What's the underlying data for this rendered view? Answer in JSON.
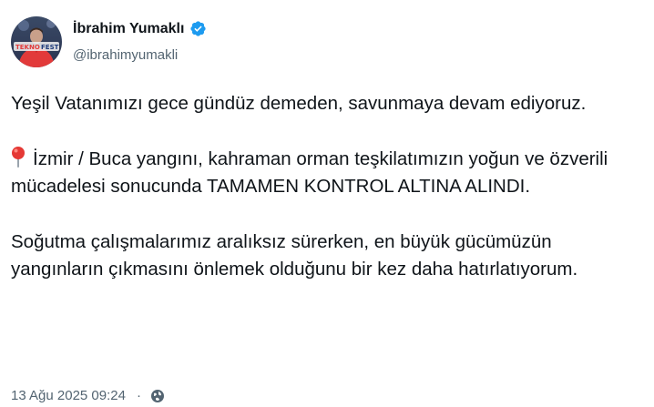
{
  "author": {
    "display_name": "İbrahim Yumaklı",
    "handle": "@ibrahimyumakli",
    "verified": true,
    "verified_color": "#1d9bf0",
    "avatar_text": [
      "TEKNO",
      "FEST"
    ]
  },
  "tweet": {
    "paragraphs": [
      "Yeşil Vatanımızı gece gündüz demeden, savunmaya devam ediyoruz.",
      "İzmir / Buca yangını, kahraman orman teşkilatımızın yoğun ve özverili mücadelesi sonucunda TAMAMEN KONTROL ALTINA ALINDI.",
      "Soğutma çalışmalarımız aralıksız sürerken, en büyük gücümüzün yangınların çıkmasını önlemek olduğunu bir kez daha hatırlatıyorum."
    ],
    "pin_emoji": "round-pushpin-icon"
  },
  "meta": {
    "timestamp": "13 Ağu 2025 09:24",
    "separator": "·",
    "visibility_icon": "globe-icon"
  }
}
